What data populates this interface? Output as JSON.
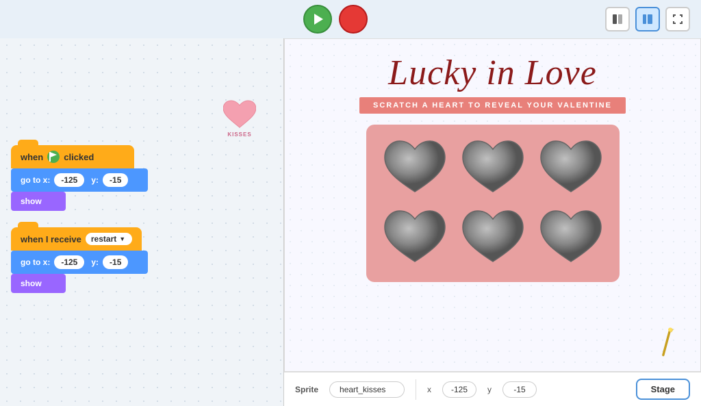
{
  "toolbar": {
    "green_flag_label": "Green Flag",
    "stop_label": "Stop",
    "layout_btn1": "⊞",
    "layout_btn2": "⊡",
    "fullscreen_btn": "⤢"
  },
  "scripts": {
    "block1": {
      "hat": "when",
      "flag": "🚩",
      "clicked": "clicked",
      "motion_label": "go to x:",
      "x_val": "-125",
      "y_label": "y:",
      "y_val": "-15",
      "looks_label": "show"
    },
    "block2": {
      "hat": "when I receive",
      "receive_val": "restart",
      "motion_label": "go to x:",
      "x_val": "-125",
      "y_label": "y:",
      "y_val": "-15",
      "looks_label": "show"
    }
  },
  "sprite_thumb": {
    "label": "KISSES"
  },
  "stage": {
    "title": "Lucky in Love",
    "subtitle": "SCRATCH A HEART TO REVEAL YOUR VALENTINE"
  },
  "bottom_bar": {
    "sprite_label": "Sprite",
    "sprite_name": "heart_kisses",
    "x_label": "x",
    "x_val": "-125",
    "y_label": "y",
    "y_val": "-15",
    "stage_btn": "Stage"
  },
  "hearts": [
    {
      "row": 0,
      "col": 0
    },
    {
      "row": 0,
      "col": 1
    },
    {
      "row": 0,
      "col": 2
    },
    {
      "row": 1,
      "col": 0
    },
    {
      "row": 1,
      "col": 1
    },
    {
      "row": 1,
      "col": 2
    }
  ]
}
